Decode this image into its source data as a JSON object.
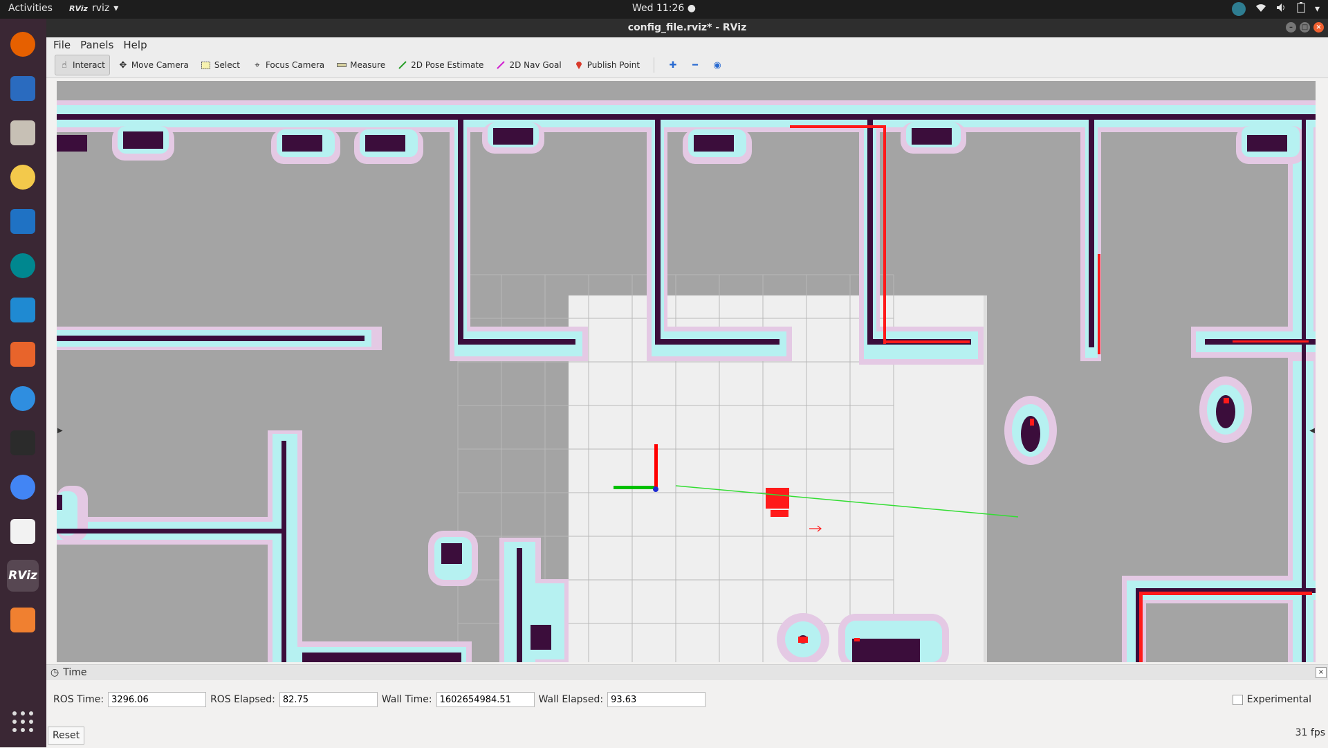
{
  "topbar": {
    "activities": "Activities",
    "app_name": "rviz",
    "app_icon_text": "RViz",
    "clock": "Wed 11:26 ●",
    "tray_icons": [
      "wifi-icon",
      "volume-icon",
      "battery-icon",
      "system-menu-chevron-icon"
    ]
  },
  "dock": {
    "items": [
      {
        "name": "firefox-icon",
        "color": "#e66000"
      },
      {
        "name": "thunderbird-icon",
        "color": "#2a6bbf"
      },
      {
        "name": "files-icon",
        "color": "#c7c0b5"
      },
      {
        "name": "rhythmbox-icon",
        "color": "#f3c94b"
      },
      {
        "name": "writer-icon",
        "color": "#1f72c4"
      },
      {
        "name": "arduino-icon",
        "color": "#00878f"
      },
      {
        "name": "vscode-icon",
        "color": "#1f8ad2"
      },
      {
        "name": "software-center-icon",
        "color": "#e8642b"
      },
      {
        "name": "help-icon",
        "color": "#2f8ee0"
      },
      {
        "name": "terminal-icon",
        "color": "#2b2b2b"
      },
      {
        "name": "chrome-icon",
        "color": "#4285f4"
      },
      {
        "name": "text-editor-icon",
        "color": "#f2f2f2"
      },
      {
        "name": "rviz-icon",
        "color": "#555555"
      },
      {
        "name": "layers-app-icon",
        "color": "#f08030"
      }
    ],
    "rviz_label": "RViz"
  },
  "window": {
    "title": "config_file.rviz* - RViz"
  },
  "menu": {
    "file": "File",
    "panels": "Panels",
    "help": "Help"
  },
  "toolbar": {
    "interact": "Interact",
    "move_camera": "Move Camera",
    "select": "Select",
    "focus_camera": "Focus Camera",
    "measure": "Measure",
    "pose_estimate": "2D Pose Estimate",
    "nav_goal": "2D Nav Goal",
    "publish_point": "Publish Point"
  },
  "time_panel": {
    "title": "Time",
    "ros_time_label": "ROS Time:",
    "ros_time": "3296.06",
    "ros_elapsed_label": "ROS Elapsed:",
    "ros_elapsed": "82.75",
    "wall_time_label": "Wall Time:",
    "wall_time": "1602654984.51",
    "wall_elapsed_label": "Wall Elapsed:",
    "wall_elapsed": "93.63",
    "experimental": "Experimental",
    "reset": "Reset",
    "fps": "31 fps"
  },
  "colors": {
    "map_unknown": "#a4a4a4",
    "map_free": "#efefef",
    "inflation_cyan": "#b6f1f1",
    "inflation_pink": "#e4c9e4",
    "wall": "#3b0d3b",
    "laser": "#ff1a1a",
    "axis_x": "#ff0000",
    "axis_y": "#00c000",
    "path": "#33dd33"
  }
}
